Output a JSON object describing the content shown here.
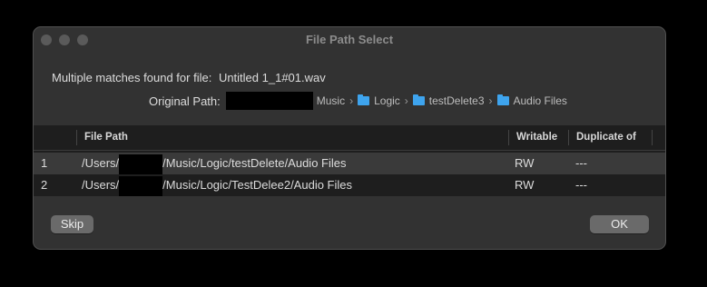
{
  "window": {
    "title": "File Path Select"
  },
  "info": {
    "multiple_label": "Multiple matches found for file:",
    "file_name": "Untitled 1_1#01.wav",
    "original_path_label": "Original Path:",
    "breadcrumbs": [
      {
        "label": "Music",
        "folder": false
      },
      {
        "label": "Logic",
        "folder": true
      },
      {
        "label": "testDelete3",
        "folder": true
      },
      {
        "label": "Audio Files",
        "folder": true
      }
    ],
    "separator": "›"
  },
  "table": {
    "columns": [
      "File Path",
      "Writable",
      "Duplicate of"
    ],
    "rows": [
      {
        "index": "1",
        "path_prefix": "/Users/",
        "path_suffix": "/Music/Logic/testDelete/Audio Files",
        "writable": "RW",
        "duplicate": "---"
      },
      {
        "index": "2",
        "path_prefix": "/Users/",
        "path_suffix": "/Music/Logic/TestDelee2/Audio Files",
        "writable": "RW",
        "duplicate": "---"
      }
    ]
  },
  "buttons": {
    "skip": "Skip",
    "ok": "OK"
  },
  "icons": {
    "folder": "folder-icon",
    "window_controls": [
      "close-icon",
      "minimize-icon",
      "zoom-icon"
    ]
  },
  "colors": {
    "folder": "#3ea4ee",
    "dialog_bg": "#323232",
    "table_bg": "#1e1e1e",
    "selected_row": "#3a3a3a"
  }
}
